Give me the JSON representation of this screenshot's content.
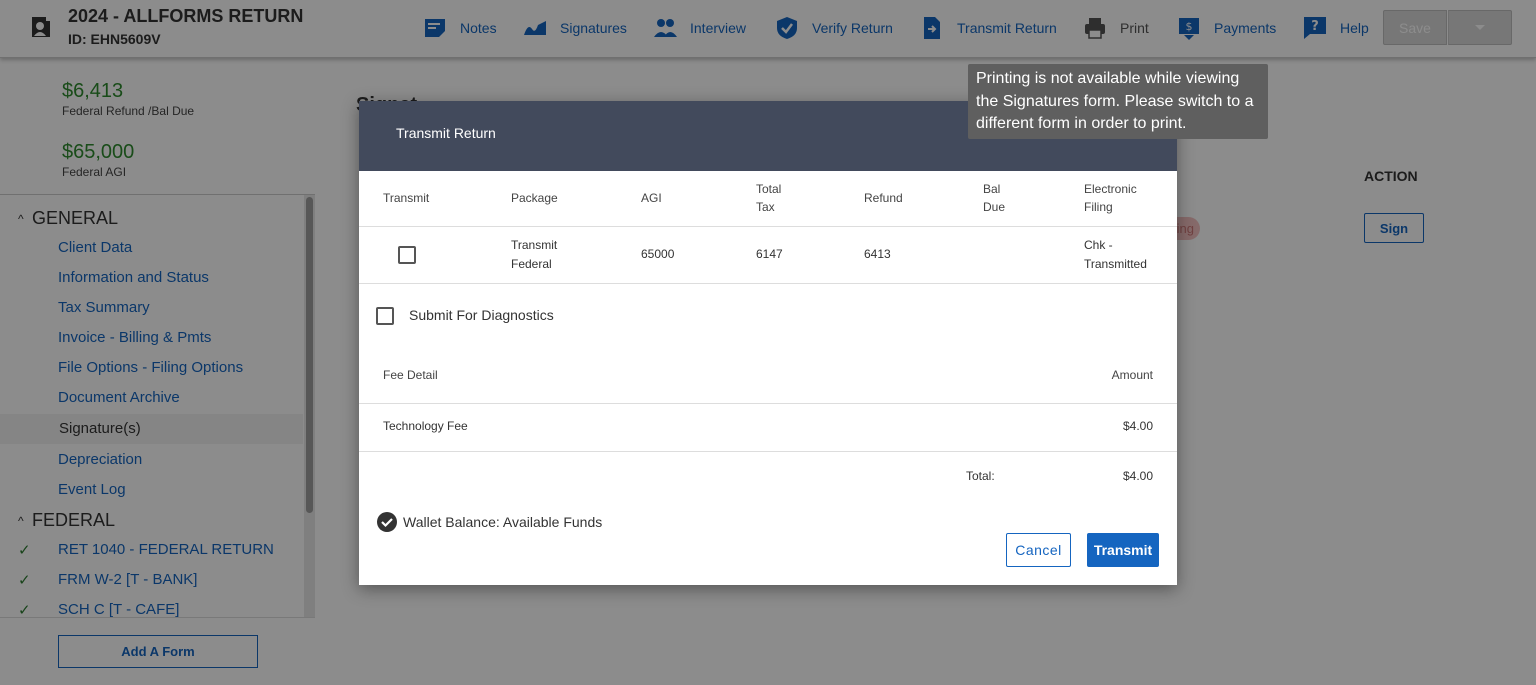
{
  "header": {
    "title": "2024 - ALLFORMS RETURN",
    "id_label": "ID: EHN5609V",
    "nav": [
      {
        "label": "Notes",
        "icon": "notes-icon"
      },
      {
        "label": "Signatures",
        "icon": "signature-icon"
      },
      {
        "label": "Interview",
        "icon": "interview-icon"
      },
      {
        "label": "Verify Return",
        "icon": "verify-icon"
      },
      {
        "label": "Transmit Return",
        "icon": "transmit-icon"
      },
      {
        "label": "Print",
        "icon": "print-icon"
      },
      {
        "label": "Payments",
        "icon": "payments-icon"
      },
      {
        "label": "Help",
        "icon": "help-icon"
      }
    ],
    "save_label": "Save"
  },
  "sidebar": {
    "refund_value": "$6,413",
    "refund_label": "Federal Refund /Bal Due",
    "agi_value": "$65,000",
    "agi_label": "Federal AGI",
    "general_header": "GENERAL",
    "general_items": [
      "Client Data",
      "Information and Status",
      "Tax Summary",
      "Invoice - Billing & Pmts",
      "File Options - Filing Options",
      "Document Archive",
      "Signature(s)",
      "Depreciation",
      "Event Log"
    ],
    "federal_header": "FEDERAL",
    "federal_items": [
      "RET 1040 - FEDERAL RETURN",
      "FRM W-2 [T - BANK]",
      "SCH C [T - CAFE]"
    ],
    "add_form_label": "Add A Form"
  },
  "main": {
    "title": "Signat",
    "action_header": "ACTION",
    "status_pill": "ing",
    "sign_label": "Sign"
  },
  "dialog": {
    "title": "Transmit Return",
    "columns": {
      "transmit": "Transmit",
      "package": "Package",
      "agi": "AGI",
      "total_tax_1": "Total",
      "total_tax_2": "Tax",
      "refund": "Refund",
      "bal_due_1": "Bal",
      "bal_due_2": "Due",
      "efile_1": "Electronic",
      "efile_2": "Filing"
    },
    "row": {
      "package_1": "Transmit",
      "package_2": "Federal",
      "agi": "65000",
      "total_tax": "6147",
      "refund": "6413",
      "bal_due": "",
      "efile_1": "Chk -",
      "efile_2": "Transmitted"
    },
    "diagnostics_label": "Submit For Diagnostics",
    "fee_detail_header": "Fee Detail",
    "amount_header": "Amount",
    "fee_name": "Technology Fee",
    "fee_amount": "$4.00",
    "total_label": "Total:",
    "total_value": "$4.00",
    "wallet_label": "Wallet Balance: Available Funds",
    "cancel_label": "Cancel",
    "transmit_label": "Transmit"
  },
  "tooltip": {
    "text": "Printing is not available while viewing the Signatures form. Please switch to a different form in order to print."
  },
  "colors": {
    "accent": "#1565c0",
    "dialog_header": "#424a5c",
    "success": "#2e8b2e",
    "tooltip": "#5f5f5f"
  }
}
